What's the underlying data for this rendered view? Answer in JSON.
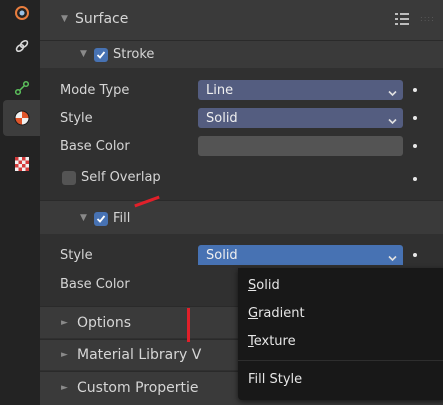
{
  "tabs": [
    {
      "icon": "world-icon",
      "active": false
    },
    {
      "icon": "constraint-link-icon",
      "active": false
    },
    {
      "icon": "modifier-wrench-icon",
      "active": false
    },
    {
      "icon": "material-shading-icon",
      "active": true
    },
    {
      "icon": "texture-checker-icon",
      "active": false
    }
  ],
  "surface": {
    "title": "Surface"
  },
  "stroke": {
    "title": "Stroke",
    "mode_type_label": "Mode Type",
    "mode_type_value": "Line",
    "style_label": "Style",
    "style_value": "Solid",
    "base_color_label": "Base Color",
    "self_overlap_label": "Self Overlap"
  },
  "fill": {
    "title": "Fill",
    "style_label": "Style",
    "style_value": "Solid",
    "base_color_label": "Base Color"
  },
  "collapsed_panels": {
    "options": "Options",
    "material_library": "Material Library V",
    "custom_properties": "Custom Propertie"
  },
  "dropdown_menu": {
    "items": [
      "Solid",
      "Gradient",
      "Texture"
    ],
    "title": "Fill Style"
  },
  "colors": {
    "accent": "#4772b3",
    "dropdown_blue": "#545d80",
    "annotation_red": "#e0202a"
  }
}
